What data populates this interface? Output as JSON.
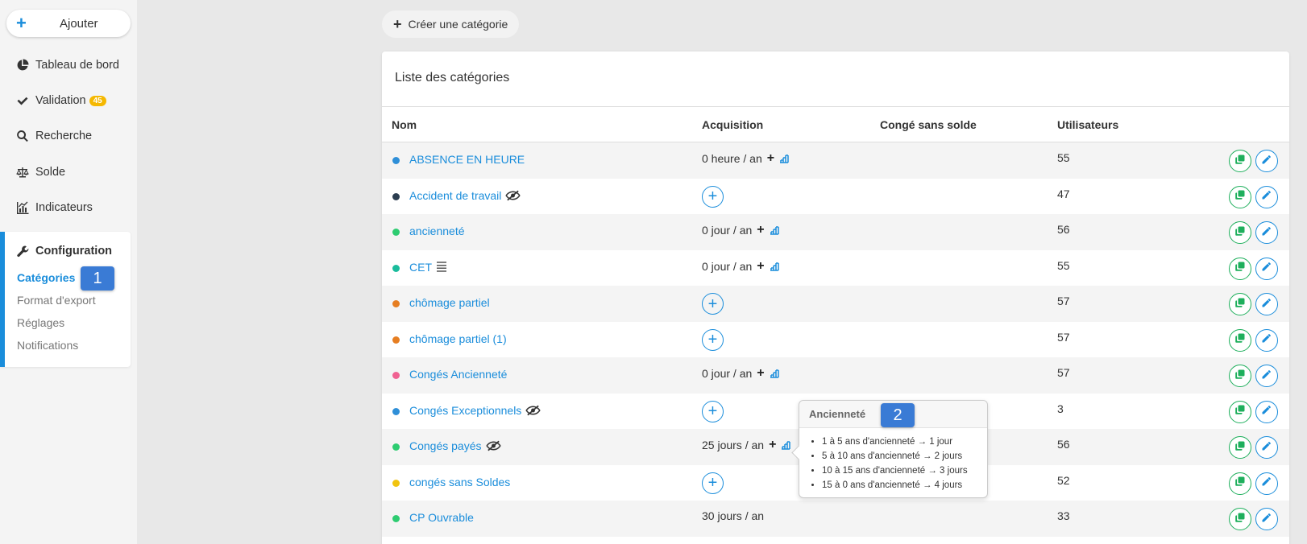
{
  "sidebar": {
    "add_label": "Ajouter",
    "nav": [
      {
        "label": "Tableau de bord",
        "icon": "pie-chart-icon"
      },
      {
        "label": "Validation",
        "icon": "check-icon",
        "badge": "45"
      },
      {
        "label": "Recherche",
        "icon": "search-icon"
      },
      {
        "label": "Solde",
        "icon": "balance-scale-icon"
      },
      {
        "label": "Indicateurs",
        "icon": "bar-chart-icon"
      }
    ],
    "config": {
      "title": "Configuration",
      "items": [
        "Catégories",
        "Format d'export",
        "Réglages",
        "Notifications"
      ],
      "active_index": 0
    }
  },
  "markers": {
    "one": "1",
    "two": "2"
  },
  "create_label": "Créer une catégorie",
  "panel": {
    "title": "Liste des catégories",
    "columns": {
      "name": "Nom",
      "acquisition": "Acquisition",
      "unpaid": "Congé sans solde",
      "users": "Utilisateurs"
    }
  },
  "rows": [
    {
      "name": "ABSENCE EN HEURE",
      "color": "#2f8fd8",
      "acq": "0 heure / an",
      "acq_extra": true,
      "users": "55",
      "extra_icon": ""
    },
    {
      "name": "Accident de travail",
      "color": "#2c3e50",
      "acq": "",
      "acq_extra": false,
      "users": "47",
      "extra_icon": "eye-slash-icon"
    },
    {
      "name": "ancienneté",
      "color": "#2ecc71",
      "acq": "0 jour / an",
      "acq_extra": true,
      "users": "56",
      "extra_icon": ""
    },
    {
      "name": "CET",
      "color": "#1abc9c",
      "acq": "0 jour / an",
      "acq_extra": true,
      "users": "55",
      "extra_icon": "list-icon"
    },
    {
      "name": "chômage partiel",
      "color": "#e67e22",
      "acq": "",
      "acq_extra": false,
      "users": "57",
      "extra_icon": ""
    },
    {
      "name": "chômage partiel (1)",
      "color": "#e67e22",
      "acq": "",
      "acq_extra": false,
      "users": "57",
      "extra_icon": ""
    },
    {
      "name": "Congés Ancienneté",
      "color": "#f06292",
      "acq": "0 jour / an",
      "acq_extra": true,
      "users": "57",
      "extra_icon": ""
    },
    {
      "name": "Congés Exceptionnels",
      "color": "#2f8fd8",
      "acq": "",
      "acq_extra": false,
      "users": "3",
      "extra_icon": "eye-slash-icon"
    },
    {
      "name": "Congés payés",
      "color": "#2ecc71",
      "acq": "25 jours / an",
      "acq_extra": true,
      "users": "56",
      "extra_icon": "eye-slash-icon"
    },
    {
      "name": "congés sans Soldes",
      "color": "#f1c40f",
      "acq": "",
      "acq_extra": false,
      "users": "52",
      "extra_icon": ""
    },
    {
      "name": "CP Ouvrable",
      "color": "#2ecc71",
      "acq": "30 jours / an",
      "acq_extra": false,
      "users": "33",
      "extra_icon": ""
    }
  ],
  "tooltip": {
    "title": "Ancienneté",
    "items": [
      "1 à 5 ans d'ancienneté → 1 jour",
      "5 à 10 ans d'ancienneté → 2 jours",
      "10 à 15 ans d'ancienneté → 3 jours",
      "15 à 0 ans d'ancienneté → 4 jours"
    ]
  },
  "colors": {
    "accent": "#1a8ddb",
    "copy": "#1eaf5c",
    "badge": "#f5b800",
    "marker": "#3a7bd5"
  }
}
